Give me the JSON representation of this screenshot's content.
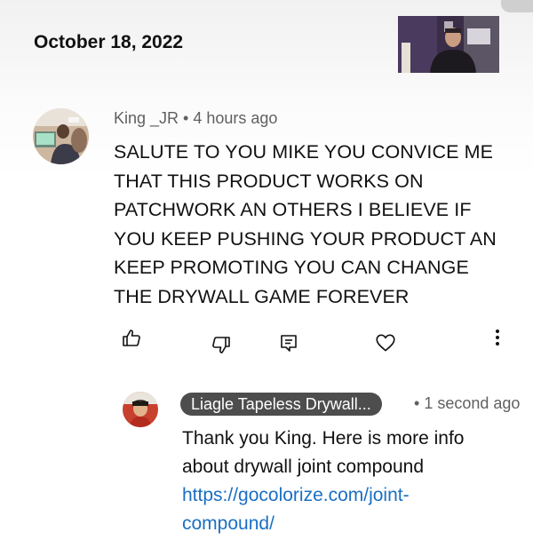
{
  "header": {
    "date": "October 18, 2022"
  },
  "video_thumbnail": {
    "icon": "video-thumbnail"
  },
  "comment": {
    "author": "King _JR",
    "separator": "•",
    "time": "4 hours ago",
    "lines": [
      "SALUTE TO YOU MIKE YOU CONVICE ME",
      "THAT THIS PRODUCT WORKS ON",
      "PATCHWORK AN OTHERS I BELIEVE IF",
      "YOU KEEP PUSHING YOUR PRODUCT AN",
      "KEEP PROMOTING YOU CAN CHANGE",
      "THE DRYWALL GAME FOREVER"
    ],
    "actions": [
      {
        "name": "like",
        "icon": "thumbs-up-icon"
      },
      {
        "name": "dislike",
        "icon": "thumbs-down-icon"
      },
      {
        "name": "reply",
        "icon": "reply-icon"
      },
      {
        "name": "heart",
        "icon": "heart-icon"
      },
      {
        "name": "more",
        "icon": "more-vertical-icon"
      }
    ]
  },
  "reply": {
    "author": "Liagle Tapeless Drywall...",
    "separator": "•",
    "time": "1 second ago",
    "text_line1": "Thank you King. Here is more info",
    "text_line2": "about drywall joint compound",
    "link_line1": "https://gocolorize.com/joint-",
    "link_line2": "compound/",
    "link_color": "#1a6fc4"
  }
}
